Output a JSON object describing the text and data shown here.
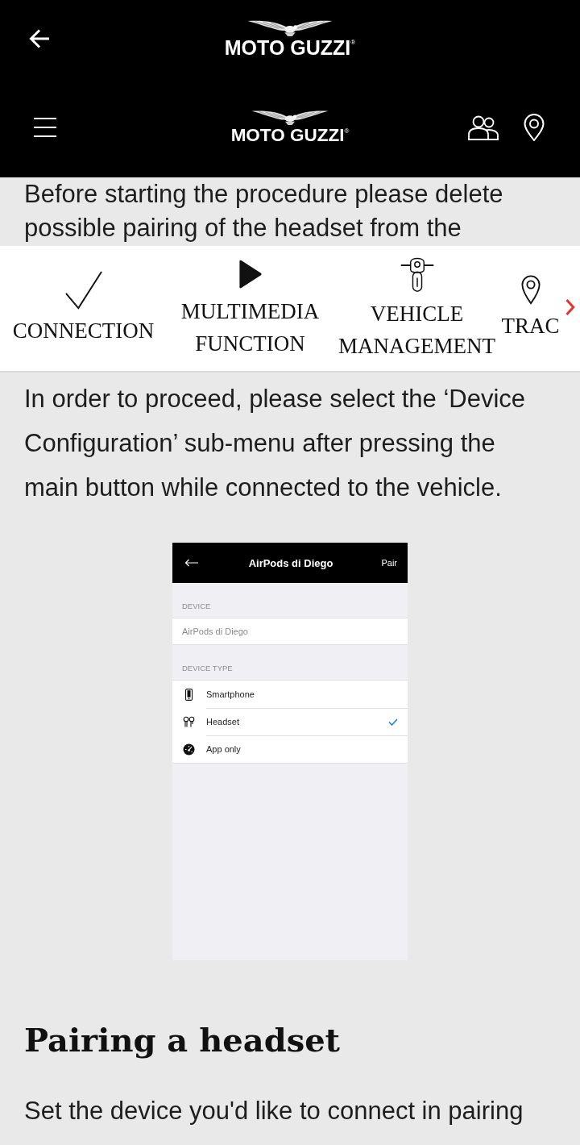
{
  "header": {
    "top_bar": {
      "logo_text": "MOTO GUZZI$^{®}$"
    },
    "nav_bar": {
      "logo_text": "MOTO GUZZI$^{®}$"
    }
  },
  "intro": {
    "text": "Before starting the procedure please delete possible pairing of the headset from the"
  },
  "section_tabs": [
    {
      "kind": "check",
      "label": "CONNECTION"
    },
    {
      "kind": "play",
      "label": "MULTIMEDIA FUNCTION"
    },
    {
      "kind": "motorcycle",
      "label": "VEHICLE MANAGEMENT"
    },
    {
      "kind": "pin",
      "label": "TRAC"
    }
  ],
  "instructions": {
    "text": "In order to proceed, please select the ‘Device Configuration’ sub-menu after pressing the main button while connected to the vehicle."
  },
  "app_screenshot": {
    "title": "AirPods di Diego",
    "action": "Pair",
    "device_label": "DEVICE",
    "device_name": "AirPods di Diego",
    "type_label": "DEVICE TYPE",
    "device_types": [
      {
        "kind": "smartphone",
        "label": "Smartphone",
        "selected": false
      },
      {
        "kind": "headset",
        "label": "Headset",
        "selected": true
      },
      {
        "kind": "app",
        "label": "App only",
        "selected": false
      }
    ]
  },
  "section": {
    "heading": "Pairing a headset",
    "text": "Set the device you'd like to connect in pairing"
  }
}
